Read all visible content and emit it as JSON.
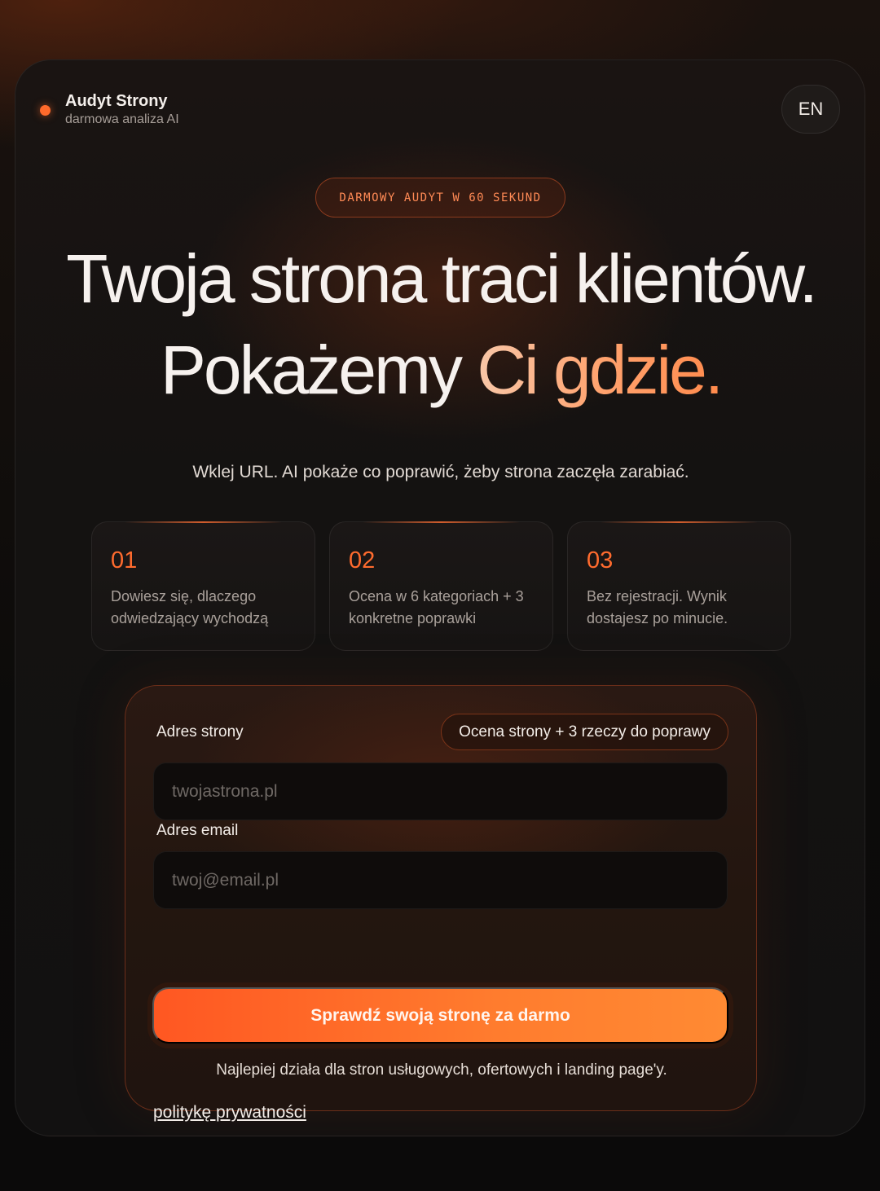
{
  "brand": {
    "title": "Audyt Strony",
    "subtitle": "darmowa analiza AI"
  },
  "header": {
    "lang_label": "EN"
  },
  "hero": {
    "pill": "DARMOWY AUDYT W 60 SEKUND",
    "headline_line1": "Twoja strona traci klientów.",
    "headline_line2_a": "Pokażemy ",
    "headline_line2_b": "Ci gdzie.",
    "lede": "Wklej URL. AI pokaże co poprawić, żeby strona zaczęła zarabiać."
  },
  "steps": [
    {
      "num": "01",
      "text": "Dowiesz się, dlaczego odwiedzający wychodzą"
    },
    {
      "num": "02",
      "text": "Ocena w 6 kategoriach + 3 konkretne poprawki"
    },
    {
      "num": "03",
      "text": "Bez rejestracji. Wynik dostajesz po minucie."
    }
  ],
  "form": {
    "url_label": "Adres strony",
    "badge": "Ocena strony + 3 rzeczy do poprawy",
    "url_placeholder": "twojastrona.pl",
    "email_label": "Adres email",
    "email_placeholder": "twoj@email.pl",
    "submit_label": "Sprawdź swoją stronę za darmo",
    "note": "Najlepiej działa dla stron usługowych, ofertowych i landing page'y.",
    "privacy_link": "politykę prywatności"
  },
  "colors": {
    "accent": "#ff6a2b",
    "background": "#121111"
  }
}
